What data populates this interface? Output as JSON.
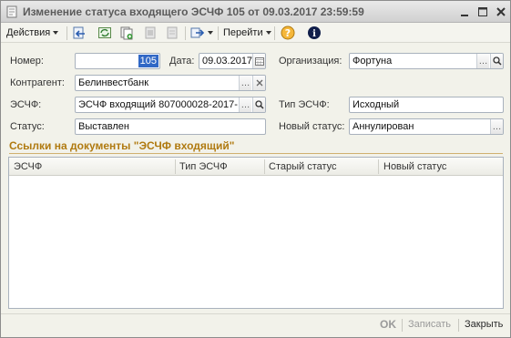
{
  "window": {
    "title": "Изменение статуса входящего ЭСЧФ 105 от 09.03.2017 23:59:59"
  },
  "toolbar": {
    "actions_label": "Действия",
    "goto_label": "Перейти"
  },
  "form": {
    "number_label": "Номер:",
    "number_value": "105",
    "date_label": "Дата:",
    "date_value": "09.03.2017",
    "org_label": "Организация:",
    "org_value": "Фортуна",
    "counterparty_label": "Контрагент:",
    "counterparty_value": "Белинвестбанк",
    "esf_label": "ЭСЧФ:",
    "esf_value": "ЭСЧФ входящий 807000028-2017-",
    "esf_type_label": "Тип ЭСЧФ:",
    "esf_type_value": "Исходный",
    "status_label": "Статус:",
    "status_value": "Выставлен",
    "new_status_label": "Новый статус:",
    "new_status_value": "Аннулирован"
  },
  "links": {
    "title": "Ссылки на документы \"ЭСЧФ входящий\"",
    "columns": [
      "ЭСЧФ",
      "Тип ЭСЧФ",
      "Старый статус",
      "Новый статус"
    ]
  },
  "footer": {
    "ok_label": "OK",
    "save_label": "Записать",
    "close_label": "Закрыть"
  }
}
